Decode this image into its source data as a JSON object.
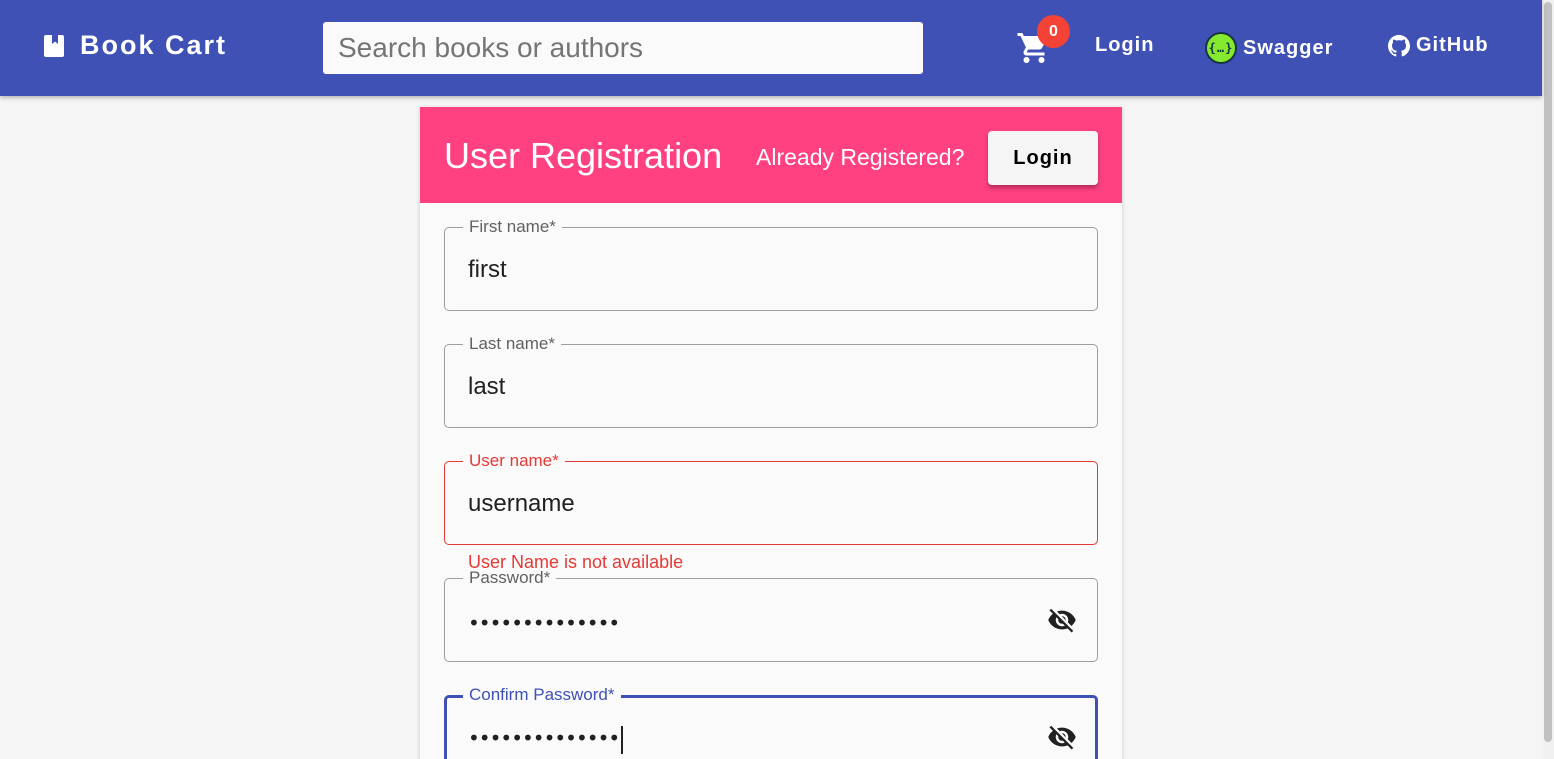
{
  "toolbar": {
    "brand": "Book Cart",
    "search_placeholder": "Search books or authors",
    "cart_count": "0",
    "login_label": "Login",
    "swagger_label": "Swagger",
    "github_label": "GitHub",
    "background_color": "#3f51b5"
  },
  "registration": {
    "title": "User Registration",
    "already_registered": "Already Registered?",
    "login_button": "Login",
    "header_color": "#ff4081",
    "fields": {
      "first_name": {
        "label": "First name*",
        "value": "first"
      },
      "last_name": {
        "label": "Last name*",
        "value": "last"
      },
      "user_name": {
        "label": "User name*",
        "value": "username",
        "error": "User Name is not available"
      },
      "password": {
        "label": "Password*",
        "value": "••••••••••••••"
      },
      "confirm_password": {
        "label": "Confirm Password*",
        "value": "••••••••••••••"
      }
    }
  },
  "icons": {
    "brand": "book-icon",
    "cart": "shopping-cart-icon",
    "swagger": "swagger-icon",
    "github": "github-icon",
    "password_toggle": "visibility-off-icon"
  }
}
